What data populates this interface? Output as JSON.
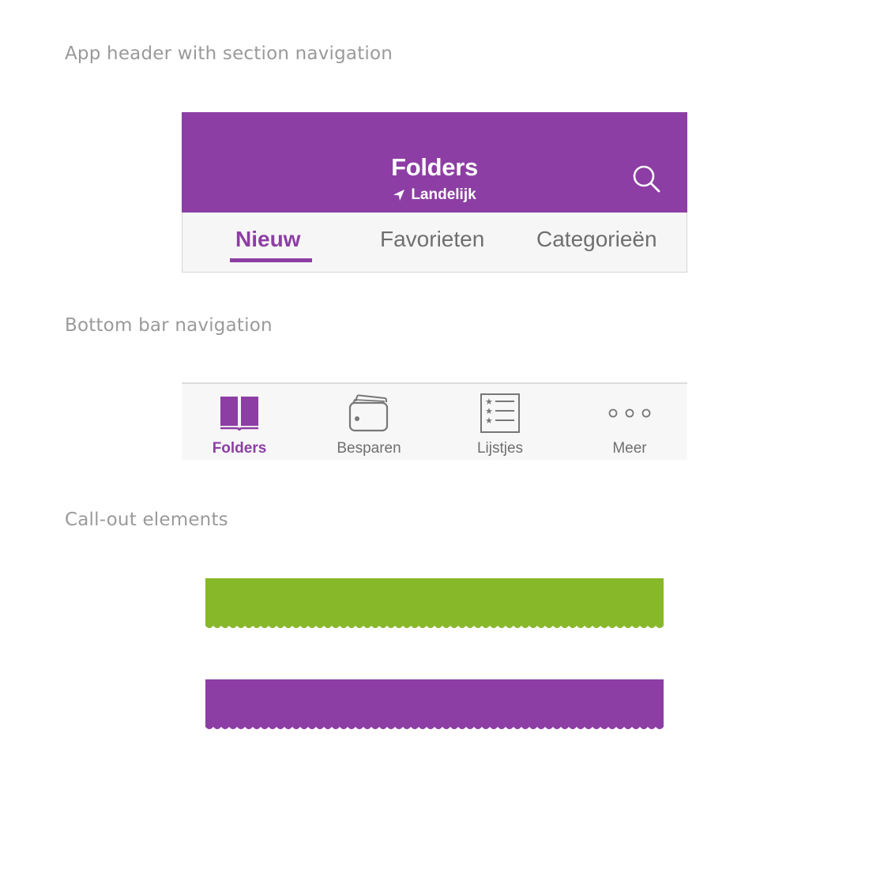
{
  "sections": {
    "header_label": "App header with section navigation",
    "bottom_label": "Bottom bar navigation",
    "callout_label": "Call-out elements"
  },
  "app_header": {
    "title": "Folders",
    "location": "Landelijk",
    "location_icon": "location-arrow-icon",
    "search_icon": "search-icon",
    "tabs": [
      {
        "label": "Nieuw",
        "active": true
      },
      {
        "label": "Favorieten",
        "active": false
      },
      {
        "label": "Categorieën",
        "active": false
      }
    ]
  },
  "bottom_bar": {
    "items": [
      {
        "label": "Folders",
        "icon": "book-icon",
        "active": true
      },
      {
        "label": "Besparen",
        "icon": "wallet-icon",
        "active": false
      },
      {
        "label": "Lijstjes",
        "icon": "list-icon",
        "active": false
      },
      {
        "label": "Meer",
        "icon": "more-dots-icon",
        "active": false
      }
    ]
  },
  "callouts": [
    {
      "color": "#87b82a"
    },
    {
      "color": "#8d3ea4"
    }
  ],
  "colors": {
    "brand": "#8d3ea4",
    "accent_green": "#87b82a",
    "muted_text": "#6f6f6f",
    "section_label": "#9a9a9a"
  }
}
